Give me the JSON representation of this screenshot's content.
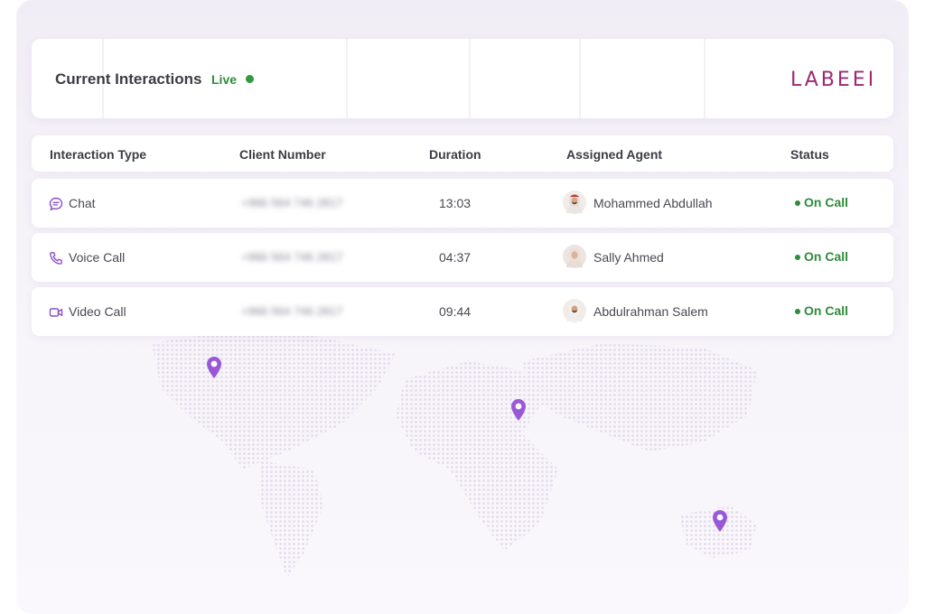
{
  "header": {
    "title": "Current Interactions",
    "live_label": "Live",
    "logo_text": "LABEEB"
  },
  "table": {
    "columns": [
      "Interaction Type",
      "Client Number",
      "Duration",
      "Assigned Agent",
      "Status"
    ],
    "rows": [
      {
        "type": "Chat",
        "type_icon": "chat-bubble-icon",
        "client": "+966 564 746 2817",
        "duration": "13:03",
        "agent": "Mohammed Abdullah",
        "status": "On Call"
      },
      {
        "type": "Voice Call",
        "type_icon": "phone-icon",
        "client": "+966 564 746 2817",
        "duration": "04:37",
        "agent": "Sally Ahmed",
        "status": "On Call"
      },
      {
        "type": "Video Call",
        "type_icon": "video-camera-icon",
        "client": "+966 564 746 2817",
        "duration": "09:44",
        "agent": "Abdulrahman Salem",
        "status": "On Call"
      }
    ]
  },
  "map": {
    "pins": [
      "north-america",
      "middle-east",
      "australia"
    ]
  },
  "colors": {
    "accent": "#8a4fc4",
    "status_green": "#2e8b3b",
    "logo_magenta": "#9c2a73",
    "background": "#f3eff7"
  }
}
